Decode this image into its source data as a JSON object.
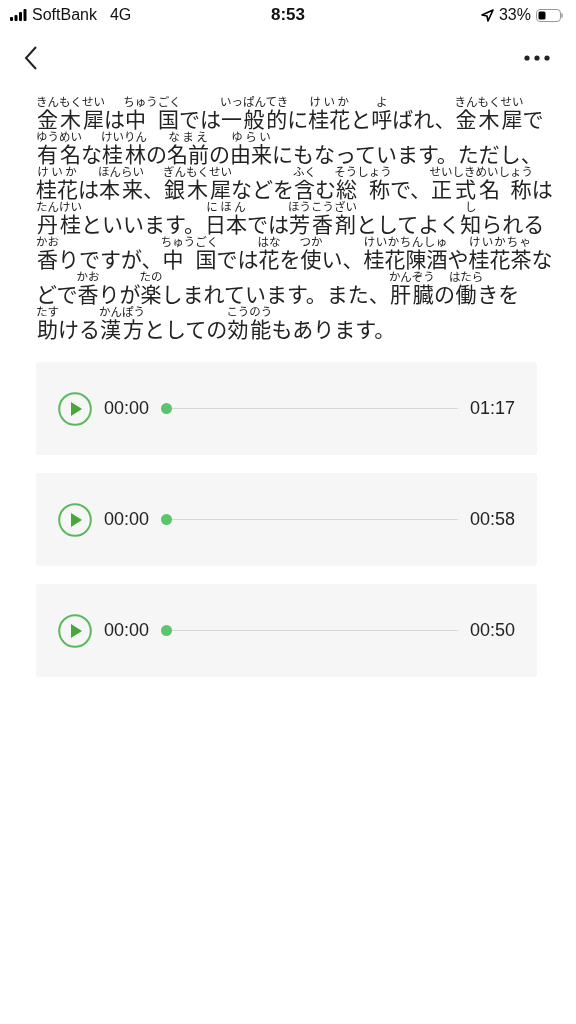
{
  "status_bar": {
    "carrier": "SoftBank",
    "network": "4G",
    "time": "8:53",
    "battery": "33%"
  },
  "article": {
    "lines": [
      [
        {
          "text": "金木犀",
          "ruby": "きんもくせい"
        },
        {
          "text": "は"
        },
        {
          "text": "中 国",
          "ruby": "ちゅうごく"
        },
        {
          "text": "では"
        },
        {
          "text": "一般的",
          "ruby": "いっぱんてき"
        },
        {
          "text": "に"
        },
        {
          "text": "桂花",
          "ruby": "けいか"
        },
        {
          "text": "と"
        },
        {
          "text": "呼",
          "ruby": "よ"
        },
        {
          "text": "ばれ、"
        },
        {
          "text": "金木犀",
          "ruby": "きんもくせい"
        },
        {
          "text": "で"
        }
      ],
      [
        {
          "text": "有名",
          "ruby": "ゆうめい"
        },
        {
          "text": "な"
        },
        {
          "text": "桂林",
          "ruby": "けいりん"
        },
        {
          "text": "の"
        },
        {
          "text": "名前",
          "ruby": "なまえ"
        },
        {
          "text": "の"
        },
        {
          "text": "由来",
          "ruby": "ゆらい"
        },
        {
          "text": "にもなっています。ただし、"
        }
      ],
      [
        {
          "text": "桂花",
          "ruby": "けいか"
        },
        {
          "text": "は"
        },
        {
          "text": "本来",
          "ruby": "ほんらい"
        },
        {
          "text": "、"
        },
        {
          "text": "銀木犀",
          "ruby": "ぎんもくせい"
        },
        {
          "text": "などを"
        },
        {
          "text": "含",
          "ruby": "ふく"
        },
        {
          "text": "む"
        },
        {
          "text": "総 称",
          "ruby": "そうしょう"
        },
        {
          "text": "で、"
        },
        {
          "text": "正式名 称",
          "ruby": "せいしきめいしょう"
        },
        {
          "text": "は"
        }
      ],
      [
        {
          "text": "丹桂",
          "ruby": "たんけい"
        },
        {
          "text": "といいます。"
        },
        {
          "text": "日本",
          "ruby": "にほん"
        },
        {
          "text": "では"
        },
        {
          "text": "芳香剤",
          "ruby": "ほうこうざい"
        },
        {
          "text": "としてよく"
        },
        {
          "text": "知",
          "ruby": "し"
        },
        {
          "text": "られる"
        }
      ],
      [
        {
          "text": "香",
          "ruby": "かお"
        },
        {
          "text": "りですが、"
        },
        {
          "text": "中 国",
          "ruby": "ちゅうごく"
        },
        {
          "text": "では"
        },
        {
          "text": "花",
          "ruby": "はな"
        },
        {
          "text": "を"
        },
        {
          "text": "使",
          "ruby": "つか"
        },
        {
          "text": "い、"
        },
        {
          "text": "桂花陳酒",
          "ruby": "けいかちんしゅ"
        },
        {
          "text": "や"
        },
        {
          "text": "桂花茶",
          "ruby": "けいかちゃ"
        },
        {
          "text": "な"
        }
      ],
      [
        {
          "text": "どで"
        },
        {
          "text": "香",
          "ruby": "かお"
        },
        {
          "text": "りが"
        },
        {
          "text": "楽",
          "ruby": "たの"
        },
        {
          "text": "しまれています。また、"
        },
        {
          "text": "肝臓",
          "ruby": "かんぞう"
        },
        {
          "text": "の"
        },
        {
          "text": "働",
          "ruby": "はたら"
        },
        {
          "text": "きを"
        }
      ],
      [
        {
          "text": "助",
          "ruby": "たす"
        },
        {
          "text": "ける"
        },
        {
          "text": "漢方",
          "ruby": "かんぽう"
        },
        {
          "text": "としての"
        },
        {
          "text": "効能",
          "ruby": "こうのう"
        },
        {
          "text": "もあります。"
        }
      ]
    ]
  },
  "players": [
    {
      "current": "00:00",
      "duration": "01:17",
      "level": 0
    },
    {
      "current": "00:00",
      "duration": "00:58",
      "level": 0
    },
    {
      "current": "00:00",
      "duration": "00:50",
      "level": 0
    }
  ]
}
